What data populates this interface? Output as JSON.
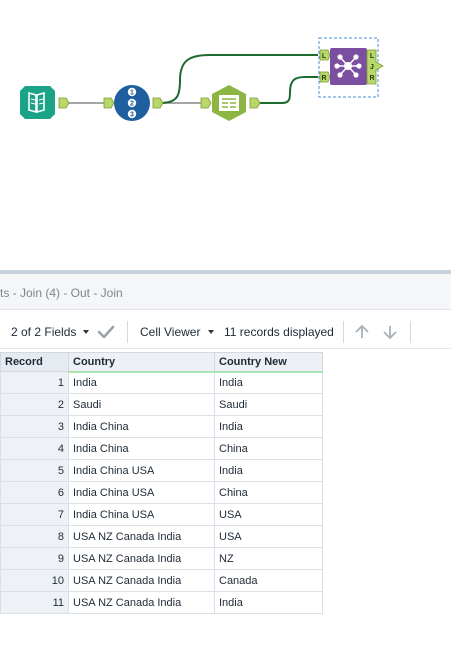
{
  "results": {
    "title": "ts - Join (4) - Out - Join",
    "fields_label": "2 of 2 Fields",
    "viewer_label": "Cell Viewer",
    "records_label": "11 records displayed"
  },
  "table": {
    "headers": [
      "Record",
      "Country",
      "Country New"
    ],
    "rows": [
      [
        "1",
        "India",
        "India"
      ],
      [
        "2",
        "Saudi",
        "Saudi"
      ],
      [
        "3",
        "India China",
        "India"
      ],
      [
        "4",
        "India China",
        "China"
      ],
      [
        "5",
        "India China USA",
        "India"
      ],
      [
        "6",
        "India China USA",
        "China"
      ],
      [
        "7",
        "India China USA",
        "USA"
      ],
      [
        "8",
        "USA NZ Canada India",
        "USA"
      ],
      [
        "9",
        "USA NZ Canada India",
        "NZ"
      ],
      [
        "10",
        "USA NZ Canada India",
        "Canada"
      ],
      [
        "11",
        "USA NZ Canada India",
        "India"
      ]
    ]
  },
  "tools": {
    "input": {
      "icon": "book-icon",
      "color": "#1aa387"
    },
    "record_id": {
      "icon": "record-id-icon",
      "color": "#1f5fa0",
      "digits": [
        "1",
        "2",
        "3"
      ]
    },
    "text_to_columns": {
      "icon": "text-to-columns-icon",
      "color": "#8db543"
    },
    "join": {
      "icon": "join-icon",
      "color": "#7a4fa0",
      "anchors_left": [
        "L",
        "R"
      ],
      "anchors_right": [
        "L",
        "J",
        "R"
      ]
    }
  },
  "colors": {
    "connector": "#1f6b2f",
    "connector_gray": "#8a8a8a",
    "anchor": "#b9d86a",
    "selection": "#4a8ed8"
  }
}
